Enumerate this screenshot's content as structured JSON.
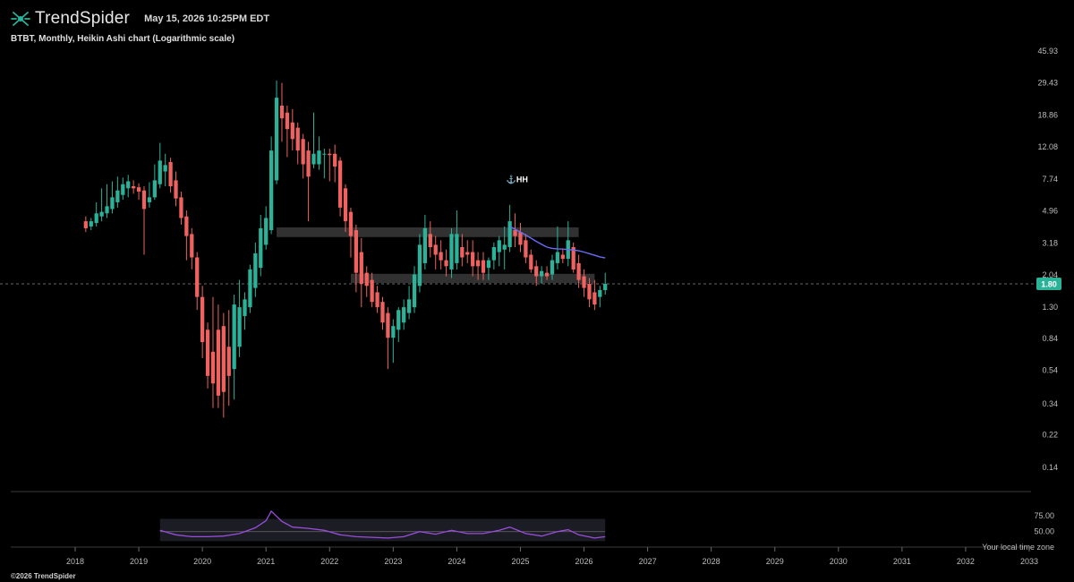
{
  "header": {
    "brand": "TrendSpider",
    "timestamp": "May 15, 2026 10:25PM EDT",
    "subtitle": "BTBT, Monthly, Heikin Ashi chart (Logarithmic scale)"
  },
  "footer": {
    "copyright": "©2026 TrendSpider",
    "local_time_note": "Your local time zone"
  },
  "colors": {
    "up": "#2bb39a",
    "down": "#f0625f",
    "ma": "#6a6cf5",
    "rsi": "#9a4ddd",
    "zone": "#3a3a3a",
    "background": "#000000",
    "last_price_badge": "#2bb39a"
  },
  "chart_data": [
    {
      "type": "candlestick",
      "title": "BTBT, Monthly, Heikin Ashi chart (Logarithmic scale)",
      "y_scale": "log",
      "ylim": [
        0.12,
        50
      ],
      "y_ticks": [
        "45.93",
        "29.43",
        "18.86",
        "12.08",
        "7.74",
        "4.96",
        "3.18",
        "2.04",
        "1.30",
        "0.84",
        "0.54",
        "0.34",
        "0.22",
        "0.14"
      ],
      "x_ticks": [
        "2018",
        "2019",
        "2020",
        "2021",
        "2022",
        "2023",
        "2024",
        "2025",
        "2026",
        "2027",
        "2028",
        "2029",
        "2030",
        "2031",
        "2032",
        "2033"
      ],
      "last_price": "1.80",
      "annotation": {
        "icon": "anchor-icon",
        "label": "HH",
        "date": "2024-11",
        "value": 7.7
      },
      "zones": [
        {
          "from": "2021-03",
          "to": "2025-12",
          "low": 3.45,
          "high": 3.95
        },
        {
          "from": "2022-05",
          "to": "2026-03",
          "low": 1.82,
          "high": 2.07
        }
      ],
      "moving_average": {
        "dates": [
          "2024-11",
          "2024-12",
          "2025-01",
          "2025-02",
          "2025-03",
          "2025-04",
          "2025-05",
          "2025-06",
          "2025-07",
          "2025-08",
          "2025-09",
          "2025-10",
          "2025-11",
          "2025-12",
          "2026-01",
          "2026-02",
          "2026-03",
          "2026-04",
          "2026-05"
        ],
        "values": [
          4.0,
          3.85,
          3.7,
          3.55,
          3.4,
          3.25,
          3.12,
          3.0,
          2.95,
          2.93,
          2.92,
          2.9,
          2.88,
          2.85,
          2.8,
          2.74,
          2.68,
          2.62,
          2.58
        ]
      },
      "candles": [
        {
          "d": "2018-03",
          "o": 4.3,
          "h": 4.6,
          "l": 3.7,
          "c": 3.9
        },
        {
          "d": "2018-04",
          "o": 4.0,
          "h": 4.5,
          "l": 3.8,
          "c": 4.3
        },
        {
          "d": "2018-05",
          "o": 4.2,
          "h": 5.6,
          "l": 4.0,
          "c": 4.8
        },
        {
          "d": "2018-06",
          "o": 4.6,
          "h": 6.8,
          "l": 4.3,
          "c": 4.9
        },
        {
          "d": "2018-07",
          "o": 4.8,
          "h": 7.2,
          "l": 4.5,
          "c": 5.3
        },
        {
          "d": "2018-08",
          "o": 5.1,
          "h": 7.5,
          "l": 4.8,
          "c": 6.0
        },
        {
          "d": "2018-09",
          "o": 5.6,
          "h": 8.0,
          "l": 5.2,
          "c": 6.6
        },
        {
          "d": "2018-10",
          "o": 6.2,
          "h": 7.9,
          "l": 5.8,
          "c": 7.2
        },
        {
          "d": "2018-11",
          "o": 6.8,
          "h": 8.2,
          "l": 6.0,
          "c": 7.5
        },
        {
          "d": "2018-12",
          "o": 7.0,
          "h": 7.6,
          "l": 6.3,
          "c": 6.8
        },
        {
          "d": "2019-01",
          "o": 6.9,
          "h": 7.3,
          "l": 5.8,
          "c": 6.5
        },
        {
          "d": "2019-02",
          "o": 6.6,
          "h": 7.0,
          "l": 2.7,
          "c": 5.1
        },
        {
          "d": "2019-03",
          "o": 5.6,
          "h": 7.4,
          "l": 5.2,
          "c": 6.0
        },
        {
          "d": "2019-04",
          "o": 6.0,
          "h": 9.5,
          "l": 5.8,
          "c": 7.6
        },
        {
          "d": "2019-05",
          "o": 7.2,
          "h": 12.8,
          "l": 6.8,
          "c": 10.0
        },
        {
          "d": "2019-06",
          "o": 8.6,
          "h": 11.0,
          "l": 7.0,
          "c": 9.4
        },
        {
          "d": "2019-07",
          "o": 9.8,
          "h": 10.4,
          "l": 6.4,
          "c": 7.0
        },
        {
          "d": "2019-08",
          "o": 7.6,
          "h": 8.6,
          "l": 5.3,
          "c": 5.9
        },
        {
          "d": "2019-09",
          "o": 6.0,
          "h": 6.5,
          "l": 4.1,
          "c": 4.5
        },
        {
          "d": "2019-10",
          "o": 4.6,
          "h": 5.0,
          "l": 2.5,
          "c": 3.5
        },
        {
          "d": "2019-11",
          "o": 3.6,
          "h": 3.9,
          "l": 2.2,
          "c": 2.6
        },
        {
          "d": "2019-12",
          "o": 2.6,
          "h": 2.8,
          "l": 1.25,
          "c": 1.5
        },
        {
          "d": "2020-01",
          "o": 1.5,
          "h": 1.75,
          "l": 0.64,
          "c": 0.8
        },
        {
          "d": "2020-02",
          "o": 0.95,
          "h": 1.05,
          "l": 0.42,
          "c": 0.5
        },
        {
          "d": "2020-03",
          "o": 0.7,
          "h": 1.5,
          "l": 0.32,
          "c": 0.45
        },
        {
          "d": "2020-04",
          "o": 0.95,
          "h": 1.35,
          "l": 0.32,
          "c": 0.38
        },
        {
          "d": "2020-05",
          "o": 1.0,
          "h": 1.2,
          "l": 0.28,
          "c": 0.4
        },
        {
          "d": "2020-06",
          "o": 0.75,
          "h": 1.25,
          "l": 0.33,
          "c": 0.5
        },
        {
          "d": "2020-07",
          "o": 0.55,
          "h": 1.55,
          "l": 0.36,
          "c": 1.35
        },
        {
          "d": "2020-08",
          "o": 0.75,
          "h": 1.9,
          "l": 0.65,
          "c": 1.3
        },
        {
          "d": "2020-09",
          "o": 1.15,
          "h": 1.6,
          "l": 0.95,
          "c": 1.45
        },
        {
          "d": "2020-10",
          "o": 1.3,
          "h": 2.35,
          "l": 1.2,
          "c": 2.2
        },
        {
          "d": "2020-11",
          "o": 1.7,
          "h": 3.2,
          "l": 1.5,
          "c": 2.75
        },
        {
          "d": "2020-12",
          "o": 2.25,
          "h": 4.7,
          "l": 2.0,
          "c": 3.9
        },
        {
          "d": "2021-01",
          "o": 3.1,
          "h": 5.3,
          "l": 2.9,
          "c": 4.5
        },
        {
          "d": "2021-02",
          "o": 3.8,
          "h": 14.0,
          "l": 3.6,
          "c": 11.5
        },
        {
          "d": "2021-03",
          "o": 7.6,
          "h": 30.5,
          "l": 7.2,
          "c": 24.0
        },
        {
          "d": "2021-04",
          "o": 21.5,
          "h": 29.5,
          "l": 13.0,
          "c": 18.0
        },
        {
          "d": "2021-05",
          "o": 19.5,
          "h": 21.5,
          "l": 10.5,
          "c": 15.5
        },
        {
          "d": "2021-06",
          "o": 17.0,
          "h": 20.5,
          "l": 11.5,
          "c": 13.5
        },
        {
          "d": "2021-07",
          "o": 15.8,
          "h": 17.0,
          "l": 9.5,
          "c": 11.5
        },
        {
          "d": "2021-08",
          "o": 13.5,
          "h": 14.5,
          "l": 7.8,
          "c": 9.5
        },
        {
          "d": "2021-09",
          "o": 11.5,
          "h": 13.0,
          "l": 4.3,
          "c": 8.0
        },
        {
          "d": "2021-10",
          "o": 9.5,
          "h": 19.5,
          "l": 9.0,
          "c": 11.0
        },
        {
          "d": "2021-11",
          "o": 9.5,
          "h": 14.0,
          "l": 8.8,
          "c": 11.5
        },
        {
          "d": "2021-12",
          "o": 11.0,
          "h": 11.8,
          "l": 7.8,
          "c": 11.0
        },
        {
          "d": "2022-01",
          "o": 11.0,
          "h": 11.8,
          "l": 7.5,
          "c": 10.8
        },
        {
          "d": "2022-02",
          "o": 11.0,
          "h": 12.5,
          "l": 7.4,
          "c": 9.2
        },
        {
          "d": "2022-03",
          "o": 10.0,
          "h": 10.5,
          "l": 4.6,
          "c": 5.2
        },
        {
          "d": "2022-04",
          "o": 6.8,
          "h": 7.2,
          "l": 3.7,
          "c": 4.3
        },
        {
          "d": "2022-05",
          "o": 4.9,
          "h": 5.2,
          "l": 2.6,
          "c": 3.5
        },
        {
          "d": "2022-06",
          "o": 3.8,
          "h": 4.1,
          "l": 1.6,
          "c": 2.1
        },
        {
          "d": "2022-07",
          "o": 2.8,
          "h": 3.4,
          "l": 1.3,
          "c": 1.8
        },
        {
          "d": "2022-08",
          "o": 2.1,
          "h": 2.3,
          "l": 1.5,
          "c": 1.75
        },
        {
          "d": "2022-09",
          "o": 1.9,
          "h": 2.1,
          "l": 1.3,
          "c": 1.4
        },
        {
          "d": "2022-10",
          "o": 1.6,
          "h": 1.75,
          "l": 1.2,
          "c": 1.3
        },
        {
          "d": "2022-11",
          "o": 1.4,
          "h": 1.5,
          "l": 0.95,
          "c": 1.05
        },
        {
          "d": "2022-12",
          "o": 1.2,
          "h": 1.3,
          "l": 0.55,
          "c": 0.85
        },
        {
          "d": "2023-01",
          "o": 0.85,
          "h": 1.1,
          "l": 0.6,
          "c": 1.0
        },
        {
          "d": "2023-02",
          "o": 0.95,
          "h": 1.3,
          "l": 0.8,
          "c": 1.25
        },
        {
          "d": "2023-03",
          "o": 1.05,
          "h": 1.45,
          "l": 0.95,
          "c": 1.3
        },
        {
          "d": "2023-04",
          "o": 1.2,
          "h": 1.75,
          "l": 1.1,
          "c": 1.45
        },
        {
          "d": "2023-05",
          "o": 1.3,
          "h": 2.3,
          "l": 1.2,
          "c": 2.05
        },
        {
          "d": "2023-06",
          "o": 1.75,
          "h": 3.6,
          "l": 1.6,
          "c": 3.1
        },
        {
          "d": "2023-07",
          "o": 2.4,
          "h": 4.7,
          "l": 2.2,
          "c": 3.9
        },
        {
          "d": "2023-08",
          "o": 3.6,
          "h": 4.3,
          "l": 2.6,
          "c": 3.0
        },
        {
          "d": "2023-09",
          "o": 3.1,
          "h": 3.5,
          "l": 2.2,
          "c": 2.7
        },
        {
          "d": "2023-10",
          "o": 2.8,
          "h": 3.3,
          "l": 2.2,
          "c": 2.5
        },
        {
          "d": "2023-11",
          "o": 2.5,
          "h": 2.9,
          "l": 2.0,
          "c": 2.3
        },
        {
          "d": "2023-12",
          "o": 2.2,
          "h": 3.9,
          "l": 1.95,
          "c": 3.6
        },
        {
          "d": "2024-01",
          "o": 2.4,
          "h": 5.0,
          "l": 2.2,
          "c": 3.6
        },
        {
          "d": "2024-02",
          "o": 3.0,
          "h": 3.6,
          "l": 2.3,
          "c": 2.6
        },
        {
          "d": "2024-03",
          "o": 2.8,
          "h": 3.3,
          "l": 2.4,
          "c": 2.7
        },
        {
          "d": "2024-04",
          "o": 2.8,
          "h": 3.3,
          "l": 2.0,
          "c": 2.3
        },
        {
          "d": "2024-05",
          "o": 2.5,
          "h": 2.8,
          "l": 1.9,
          "c": 2.3
        },
        {
          "d": "2024-06",
          "o": 2.5,
          "h": 2.8,
          "l": 1.9,
          "c": 2.1
        },
        {
          "d": "2024-07",
          "o": 2.25,
          "h": 2.6,
          "l": 1.9,
          "c": 2.5
        },
        {
          "d": "2024-08",
          "o": 2.5,
          "h": 3.2,
          "l": 2.2,
          "c": 3.0
        },
        {
          "d": "2024-09",
          "o": 2.8,
          "h": 3.5,
          "l": 2.3,
          "c": 3.3
        },
        {
          "d": "2024-10",
          "o": 2.9,
          "h": 4.0,
          "l": 2.2,
          "c": 3.1
        },
        {
          "d": "2024-11",
          "o": 3.0,
          "h": 5.4,
          "l": 2.8,
          "c": 4.3
        },
        {
          "d": "2024-12",
          "o": 3.8,
          "h": 4.8,
          "l": 3.0,
          "c": 3.5
        },
        {
          "d": "2025-01",
          "o": 3.7,
          "h": 4.2,
          "l": 2.8,
          "c": 3.1
        },
        {
          "d": "2025-02",
          "o": 3.3,
          "h": 3.6,
          "l": 2.4,
          "c": 2.6
        },
        {
          "d": "2025-03",
          "o": 2.7,
          "h": 2.9,
          "l": 2.1,
          "c": 2.2
        },
        {
          "d": "2025-04",
          "o": 2.3,
          "h": 2.5,
          "l": 1.75,
          "c": 2.0
        },
        {
          "d": "2025-05",
          "o": 2.0,
          "h": 2.3,
          "l": 1.8,
          "c": 2.15
        },
        {
          "d": "2025-06",
          "o": 2.1,
          "h": 2.3,
          "l": 1.9,
          "c": 2.0
        },
        {
          "d": "2025-07",
          "o": 2.05,
          "h": 2.7,
          "l": 1.9,
          "c": 2.5
        },
        {
          "d": "2025-08",
          "o": 2.4,
          "h": 4.0,
          "l": 2.2,
          "c": 2.8
        },
        {
          "d": "2025-09",
          "o": 2.7,
          "h": 2.95,
          "l": 2.4,
          "c": 2.55
        },
        {
          "d": "2025-10",
          "o": 2.55,
          "h": 4.3,
          "l": 2.3,
          "c": 3.3
        },
        {
          "d": "2025-11",
          "o": 3.0,
          "h": 3.2,
          "l": 2.1,
          "c": 2.2
        },
        {
          "d": "2025-12",
          "o": 2.4,
          "h": 2.7,
          "l": 1.7,
          "c": 1.9
        },
        {
          "d": "2026-01",
          "o": 2.0,
          "h": 2.2,
          "l": 1.5,
          "c": 1.7
        },
        {
          "d": "2026-02",
          "o": 1.8,
          "h": 1.95,
          "l": 1.3,
          "c": 1.45
        },
        {
          "d": "2026-03",
          "o": 1.6,
          "h": 1.9,
          "l": 1.25,
          "c": 1.35
        },
        {
          "d": "2026-04",
          "o": 1.5,
          "h": 1.75,
          "l": 1.3,
          "c": 1.65
        },
        {
          "d": "2026-05",
          "o": 1.65,
          "h": 2.1,
          "l": 1.55,
          "c": 1.8
        }
      ]
    },
    {
      "type": "line",
      "y_ticks": [
        "75.00",
        "50.00"
      ],
      "ylim": [
        30,
        100
      ],
      "band": [
        35,
        70
      ],
      "midline": 50,
      "series": [
        {
          "dates": [
            "2019-05",
            "2019-08",
            "2019-11",
            "2020-02",
            "2020-05",
            "2020-08",
            "2020-11",
            "2021-01",
            "2021-02",
            "2021-04",
            "2021-06",
            "2021-09",
            "2021-12",
            "2022-03",
            "2022-06",
            "2022-09",
            "2022-12",
            "2023-03",
            "2023-06",
            "2023-09",
            "2023-12",
            "2024-03",
            "2024-06",
            "2024-09",
            "2024-11",
            "2025-02",
            "2025-05",
            "2025-08",
            "2025-10",
            "2025-12",
            "2026-03",
            "2026-05"
          ],
          "values": [
            52,
            45,
            42,
            42,
            43,
            47,
            56,
            67,
            82,
            66,
            57,
            55,
            52,
            45,
            42,
            41,
            40,
            42,
            50,
            46,
            52,
            47,
            47,
            52,
            57,
            47,
            43,
            50,
            53,
            45,
            40,
            42
          ]
        }
      ]
    }
  ]
}
